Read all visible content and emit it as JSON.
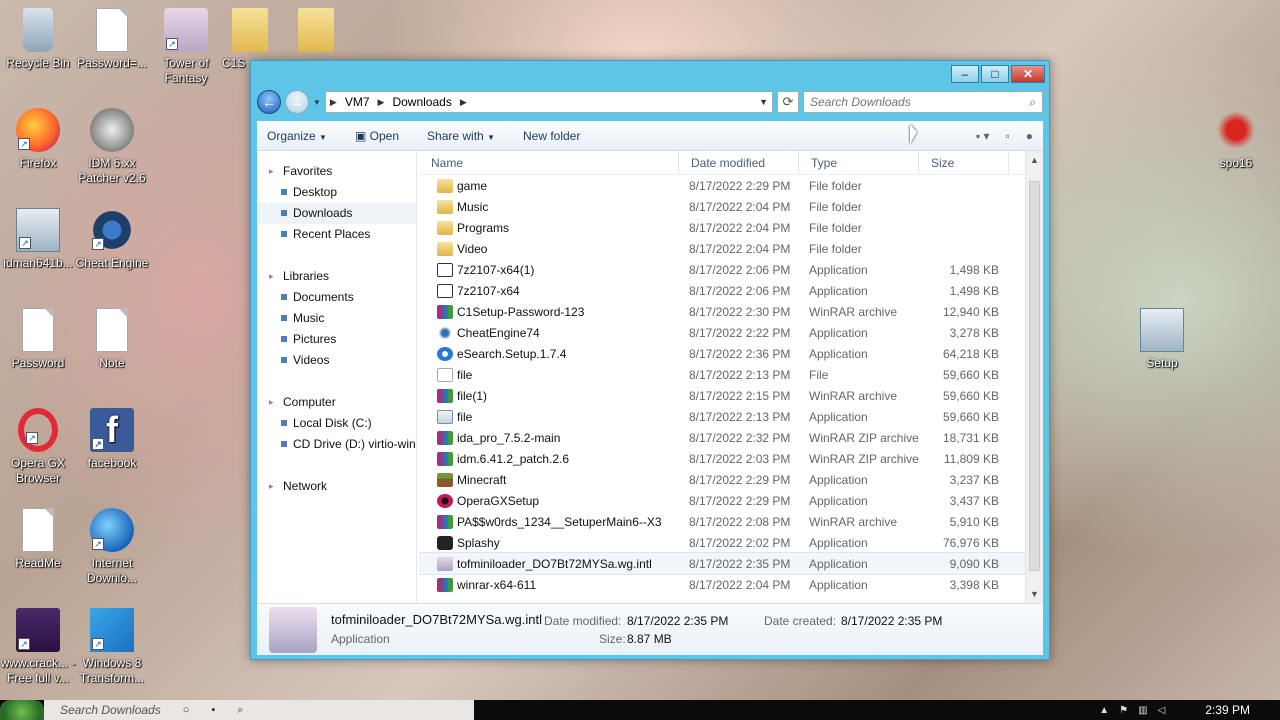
{
  "desktop": {
    "icons": [
      {
        "label": "Recycle Bin"
      },
      {
        "label": "Password=..."
      },
      {
        "label": "Tower of Fantasy"
      },
      {
        "label": "C1S"
      },
      {
        "label": ""
      },
      {
        "label": "Firefox"
      },
      {
        "label": "IDM 6.xx Patcher v2.6"
      },
      {
        "label": "idman641b..."
      },
      {
        "label": "Cheat Engine"
      },
      {
        "label": "Password"
      },
      {
        "label": "Note"
      },
      {
        "label": "Opera GX Browser"
      },
      {
        "label": "facebook"
      },
      {
        "label": "ReadMe"
      },
      {
        "label": "Internet Downlo..."
      },
      {
        "label": "www.crack... - Free full v..."
      },
      {
        "label": "Windows 8 Transform..."
      },
      {
        "label": "spo16"
      },
      {
        "label": "Setup"
      }
    ]
  },
  "window": {
    "address": {
      "segments": [
        "VM7",
        "Downloads"
      ]
    },
    "search": {
      "placeholder": "Search Downloads"
    },
    "toolbar": {
      "organize": "Organize",
      "open": "Open",
      "share_with": "Share with",
      "new_folder": "New folder"
    },
    "nav": {
      "favorites": "Favorites",
      "desktop": "Desktop",
      "downloads": "Downloads",
      "recent": "Recent Places",
      "libraries": "Libraries",
      "documents": "Documents",
      "music": "Music",
      "pictures": "Pictures",
      "videos": "Videos",
      "computer": "Computer",
      "local_disk": "Local Disk (C:)",
      "cd_drive": "CD Drive (D:) virtio-win",
      "network": "Network"
    },
    "columns": {
      "name": "Name",
      "date": "Date modified",
      "type": "Type",
      "size": "Size"
    },
    "files": [
      {
        "name": "game",
        "date": "8/17/2022 2:29 PM",
        "type": "File folder",
        "size": "",
        "icon": "folder-icon"
      },
      {
        "name": "Music",
        "date": "8/17/2022 2:04 PM",
        "type": "File folder",
        "size": "",
        "icon": "folder-icon"
      },
      {
        "name": "Programs",
        "date": "8/17/2022 2:04 PM",
        "type": "File folder",
        "size": "",
        "icon": "folder-icon"
      },
      {
        "name": "Video",
        "date": "8/17/2022 2:04 PM",
        "type": "File folder",
        "size": "",
        "icon": "folder-icon"
      },
      {
        "name": "7z2107-x64(1)",
        "date": "8/17/2022 2:06 PM",
        "type": "Application",
        "size": "1,498 KB",
        "icon": "7zip-icon"
      },
      {
        "name": "7z2107-x64",
        "date": "8/17/2022 2:06 PM",
        "type": "Application",
        "size": "1,498 KB",
        "icon": "7zip-icon"
      },
      {
        "name": "C1Setup-Password-123",
        "date": "8/17/2022 2:30 PM",
        "type": "WinRAR archive",
        "size": "12,940 KB",
        "icon": "winrar-icon"
      },
      {
        "name": "CheatEngine74",
        "date": "8/17/2022 2:22 PM",
        "type": "Application",
        "size": "3,278 KB",
        "icon": "cheat-engine-icon"
      },
      {
        "name": "eSearch.Setup.1.7.4",
        "date": "8/17/2022 2:36 PM",
        "type": "Application",
        "size": "64,218 KB",
        "icon": "esearch-icon"
      },
      {
        "name": "file",
        "date": "8/17/2022 2:13 PM",
        "type": "File",
        "size": "59,660 KB",
        "icon": "file-icon"
      },
      {
        "name": "file(1)",
        "date": "8/17/2022 2:15 PM",
        "type": "WinRAR archive",
        "size": "59,660 KB",
        "icon": "winrar-icon"
      },
      {
        "name": "file",
        "date": "8/17/2022 2:13 PM",
        "type": "Application",
        "size": "59,660 KB",
        "icon": "app-icon"
      },
      {
        "name": "ida_pro_7.5.2-main",
        "date": "8/17/2022 2:32 PM",
        "type": "WinRAR ZIP archive",
        "size": "18,731 KB",
        "icon": "winrar-icon"
      },
      {
        "name": "idm.6.41.2_patch.2.6",
        "date": "8/17/2022 2:03 PM",
        "type": "WinRAR ZIP archive",
        "size": "11,809 KB",
        "icon": "winrar-icon"
      },
      {
        "name": "Minecraft",
        "date": "8/17/2022 2:29 PM",
        "type": "Application",
        "size": "3,237 KB",
        "icon": "minecraft-icon"
      },
      {
        "name": "OperaGXSetup",
        "date": "8/17/2022 2:29 PM",
        "type": "Application",
        "size": "3,437 KB",
        "icon": "opera-icon"
      },
      {
        "name": "PA$$w0rds_1234__SetuperMain6--X3",
        "date": "8/17/2022 2:08 PM",
        "type": "WinRAR archive",
        "size": "5,910 KB",
        "icon": "winrar-icon"
      },
      {
        "name": "Splashy",
        "date": "8/17/2022 2:02 PM",
        "type": "Application",
        "size": "76,976 KB",
        "icon": "splashy-icon"
      },
      {
        "name": "tofminiloader_DO7Bt72MYSa.wg.intl",
        "date": "8/17/2022 2:35 PM",
        "type": "Application",
        "size": "9,090 KB",
        "icon": "tof-icon"
      },
      {
        "name": "winrar-x64-611",
        "date": "8/17/2022 2:04 PM",
        "type": "Application",
        "size": "3,398 KB",
        "icon": "winrar-icon"
      }
    ],
    "details": {
      "name": "tofminiloader_DO7Bt72MYSa.wg.intl",
      "type": "Application",
      "modified_label": "Date modified:",
      "modified": "8/17/2022 2:35 PM",
      "created_label": "Date created:",
      "created": "8/17/2022 2:35 PM",
      "size_label": "Size:",
      "size": "8.87 MB"
    }
  },
  "taskbar": {
    "search_text": "Search Downloads",
    "clock": "2:39 PM"
  }
}
